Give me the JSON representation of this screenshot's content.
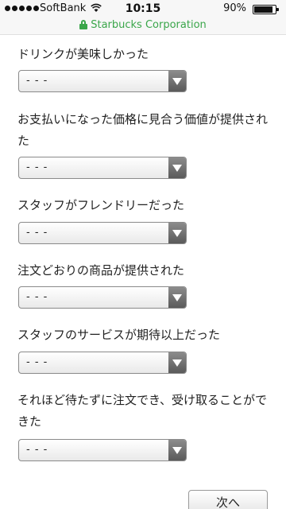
{
  "statusbar": {
    "carrier": "SoftBank",
    "time": "10:15",
    "battery": "90%",
    "battery_level": 0.9,
    "url": "Starbucks Corporation"
  },
  "questions": [
    {
      "label": "ドリンクが美味しかった",
      "value": "- - -"
    },
    {
      "label": "お支払いになった価格に見合う価値が提供された",
      "value": "- - -"
    },
    {
      "label": "スタッフがフレンドリーだった",
      "value": "- - -"
    },
    {
      "label": "注文どおりの商品が提供された",
      "value": "- - -"
    },
    {
      "label": "スタッフのサービスが期待以上だった",
      "value": "- - -"
    },
    {
      "label": "それほど待たずに注文でき、受け取ることができた",
      "value": "- - -"
    }
  ],
  "next_label": "次へ"
}
